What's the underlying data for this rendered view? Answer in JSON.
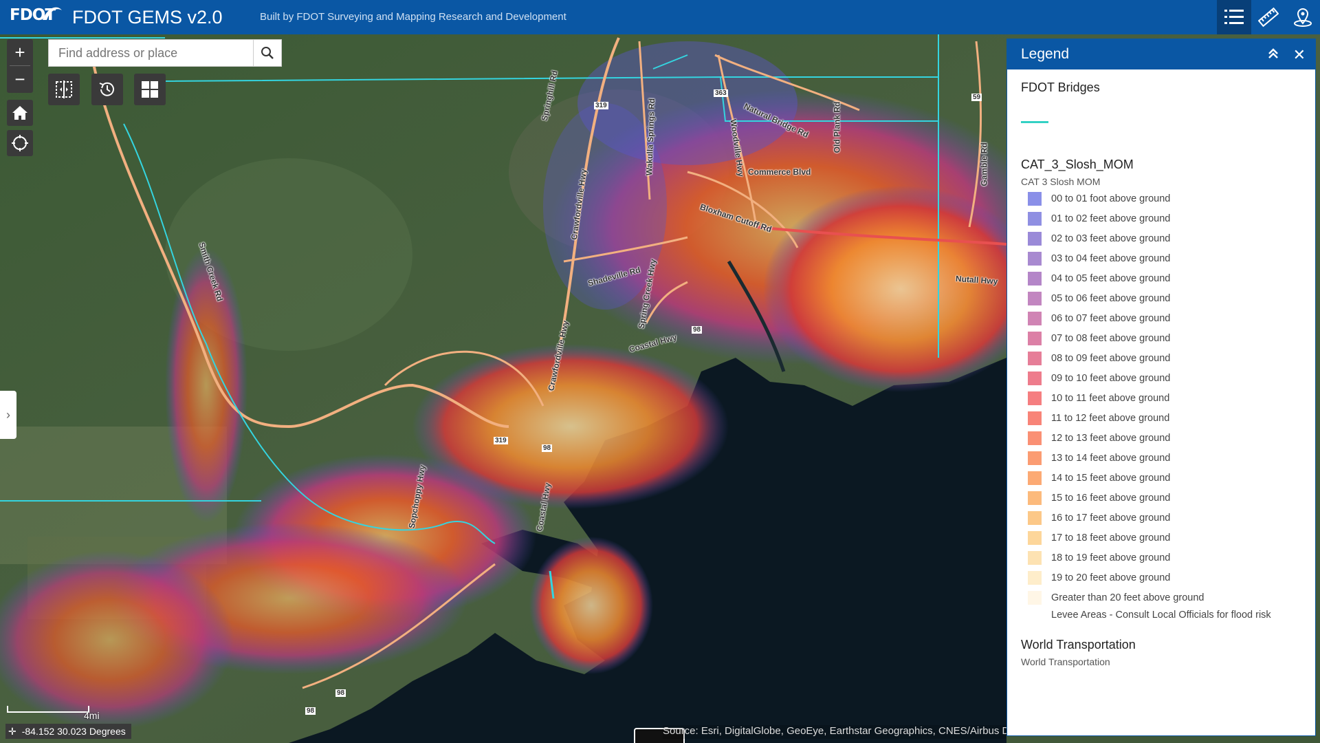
{
  "header": {
    "logo_text": "FDOT",
    "title": "FDOT GEMS v2.0",
    "subtitle": "Built by FDOT Surveying and Mapping Research and Development",
    "buttons": [
      {
        "name": "legend-list-icon",
        "active": true
      },
      {
        "name": "measure-ruler-icon",
        "active": false
      },
      {
        "name": "location-pin-icon",
        "active": false
      }
    ]
  },
  "search": {
    "placeholder": "Find address or place",
    "value": ""
  },
  "map": {
    "road_labels": [
      {
        "text": "Springhill Rd",
        "rot": -78
      },
      {
        "text": "Crawfordville Hwy",
        "rot": -82
      },
      {
        "text": "Wakulla Springs Rd",
        "rot": -88
      },
      {
        "text": "Woodville Hwy",
        "rot": 82
      },
      {
        "text": "Natural Bridge Rd",
        "rot": 25
      },
      {
        "text": "Old Plank Rd",
        "rot": -90
      },
      {
        "text": "Gamble Rd",
        "rot": -90
      },
      {
        "text": "Commerce Blvd",
        "rot": 0
      },
      {
        "text": "Bloxham Cutoff Rd",
        "rot": 18
      },
      {
        "text": "Nutall Hwy",
        "rot": 4
      },
      {
        "text": "Shadeville Rd",
        "rot": -15
      },
      {
        "text": "Spring Creek Hwy",
        "rot": -80
      },
      {
        "text": "Coastal Hwy",
        "rot": -15
      },
      {
        "text": "Crawfordville Hwy",
        "rot": -78
      },
      {
        "text": "Smith Creek Rd",
        "rot": 72
      },
      {
        "text": "Sopchoppy Hwy",
        "rot": -80
      },
      {
        "text": "Coastal Hwy",
        "rot": -80
      }
    ],
    "shields": [
      "319",
      "363",
      "59",
      "98",
      "319",
      "98",
      "98",
      "98"
    ],
    "scale_label": "4mi",
    "coordinates": "-84.152 30.023 Degrees",
    "attribution": "Source: Esri, DigitalGlobe, GeoEye, Earthstar Geographics, CNES/Airbus DS"
  },
  "legend": {
    "title": "Legend",
    "layers": [
      {
        "title": "FDOT Bridges",
        "subtitle": ""
      },
      {
        "title": "CAT_3_Slosh_MOM",
        "subtitle": "CAT 3 Slosh MOM",
        "items": [
          {
            "label": "00 to 01 foot above ground",
            "color": "#8a8fe8"
          },
          {
            "label": "01 to 02 feet above ground",
            "color": "#8f8fe2"
          },
          {
            "label": "02 to 03 feet above ground",
            "color": "#9a8ad8"
          },
          {
            "label": "03 to 04 feet above ground",
            "color": "#a88ad0"
          },
          {
            "label": "04 to 05 feet above ground",
            "color": "#b486c8"
          },
          {
            "label": "05 to 06 feet above ground",
            "color": "#c286c0"
          },
          {
            "label": "06 to 07 feet above ground",
            "color": "#d084b4"
          },
          {
            "label": "07 to 08 feet above ground",
            "color": "#dc80a6"
          },
          {
            "label": "08 to 09 feet above ground",
            "color": "#e67e98"
          },
          {
            "label": "09 to 10 feet above ground",
            "color": "#ee7c8c"
          },
          {
            "label": "10 to 11 feet above ground",
            "color": "#f57e80"
          },
          {
            "label": "11 to 12 feet above ground",
            "color": "#f88478"
          },
          {
            "label": "12 to 13 feet above ground",
            "color": "#fa9074"
          },
          {
            "label": "13 to 14 feet above ground",
            "color": "#fb9c72"
          },
          {
            "label": "14 to 15 feet above ground",
            "color": "#fcaa74"
          },
          {
            "label": "15 to 16 feet above ground",
            "color": "#fcba7c"
          },
          {
            "label": "16 to 17 feet above ground",
            "color": "#fcc888"
          },
          {
            "label": "17 to 18 feet above ground",
            "color": "#fdd69a"
          },
          {
            "label": "18 to 19 feet above ground",
            "color": "#fde2b2"
          },
          {
            "label": "19 to 20 feet above ground",
            "color": "#feedca"
          },
          {
            "label": "Greater than 20 feet above ground",
            "color": "#fff6e6"
          },
          {
            "label": "Levee Areas - Consult Local Officials for flood risk",
            "color": "#ffffff"
          }
        ]
      },
      {
        "title": "World Transportation",
        "subtitle": "World Transportation"
      }
    ]
  },
  "colors": {
    "header": "#0a57a4",
    "bridge_line": "#33d1c4"
  }
}
